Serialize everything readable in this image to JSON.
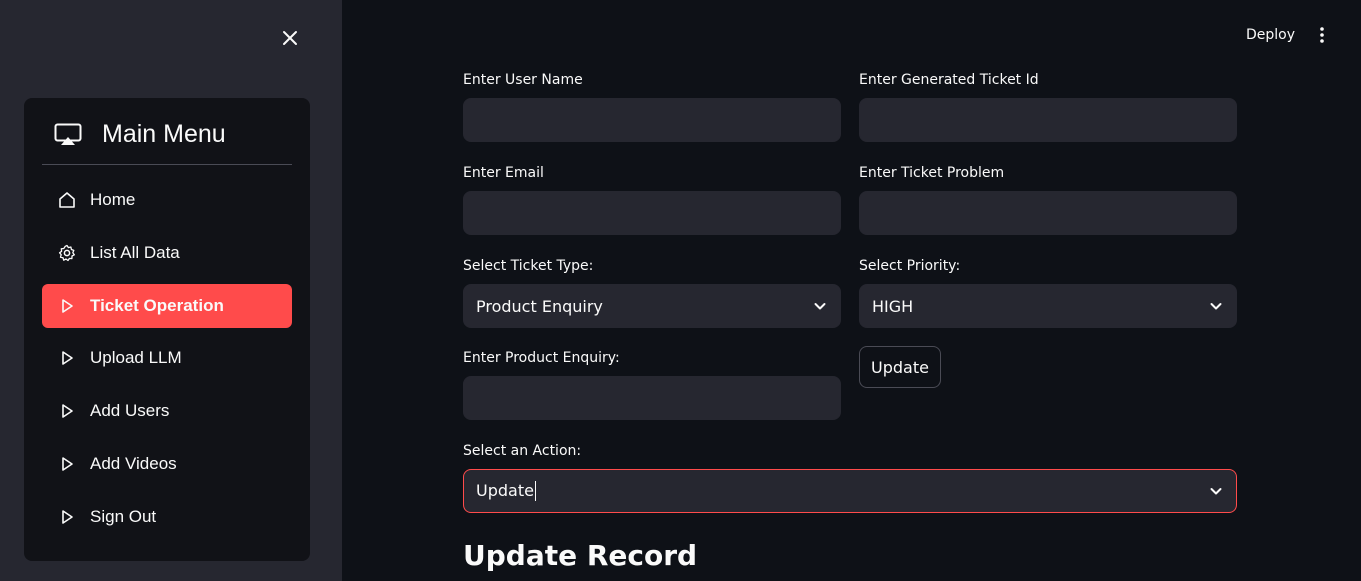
{
  "sidebar": {
    "close_icon": "close-icon",
    "menu_title": "Main Menu",
    "menu_icon": "airplay-icon",
    "items": [
      {
        "label": "Home",
        "icon": "home-icon"
      },
      {
        "label": "List All Data",
        "icon": "gear-icon"
      },
      {
        "label": "Ticket Operation",
        "icon": "play-outline-icon",
        "active": true
      },
      {
        "label": "Upload LLM",
        "icon": "play-outline-icon"
      },
      {
        "label": "Add Users",
        "icon": "play-outline-icon"
      },
      {
        "label": "Add Videos",
        "icon": "play-outline-icon"
      },
      {
        "label": "Sign Out",
        "icon": "play-outline-icon"
      }
    ],
    "active_color": "#ff4b4b"
  },
  "header": {
    "deploy_label": "Deploy",
    "menu_icon": "kebab-menu-icon"
  },
  "form": {
    "user_name_label": "Enter User Name",
    "user_name_value": "",
    "ticket_id_label": "Enter Generated Ticket Id",
    "ticket_id_value": "",
    "email_label": "Enter Email",
    "email_value": "",
    "ticket_problem_label": "Enter Ticket Problem",
    "ticket_problem_value": "",
    "ticket_type_label": "Select Ticket Type:",
    "ticket_type_value": "Product Enquiry",
    "priority_label": "Select Priority:",
    "priority_value": "HIGH",
    "product_enquiry_label": "Enter Product Enquiry:",
    "product_enquiry_value": "",
    "update_button_label": "Update",
    "action_label": "Select an Action:",
    "action_value": "Update"
  },
  "section_heading": "Update Record"
}
